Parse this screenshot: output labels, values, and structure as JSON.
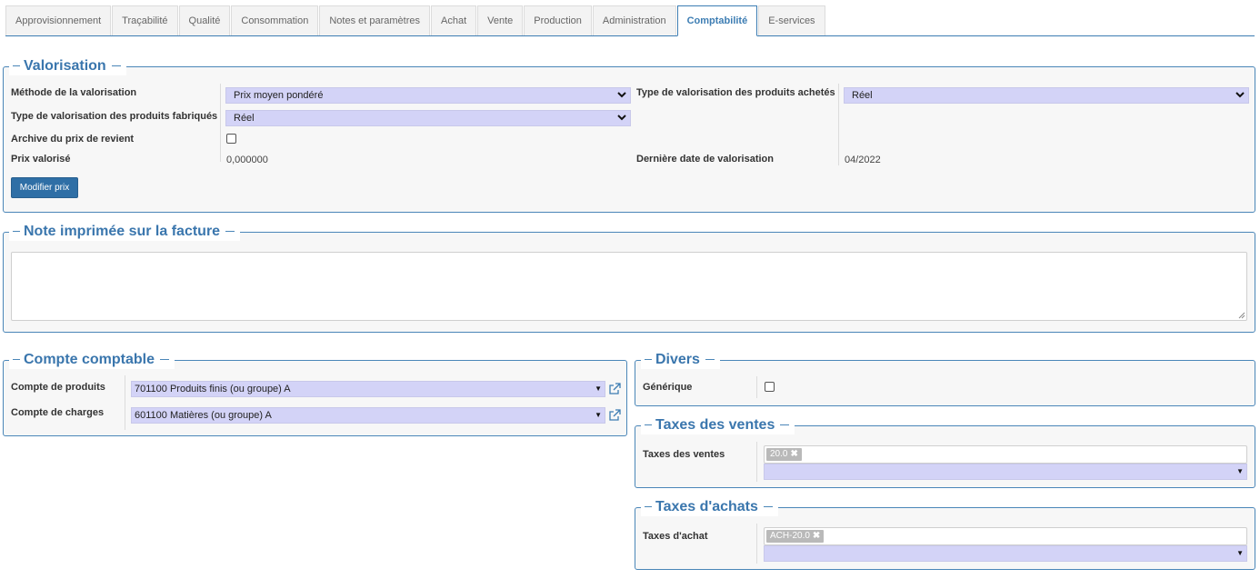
{
  "tabs": [
    {
      "label": "Approvisionnement"
    },
    {
      "label": "Traçabilité"
    },
    {
      "label": "Qualité"
    },
    {
      "label": "Consommation"
    },
    {
      "label": "Notes et paramètres"
    },
    {
      "label": "Achat"
    },
    {
      "label": "Vente"
    },
    {
      "label": "Production"
    },
    {
      "label": "Administration"
    },
    {
      "label": "Comptabilité",
      "active": true
    },
    {
      "label": "E-services"
    }
  ],
  "valorisation": {
    "legend": "Valorisation",
    "methode_label": "Méthode de la valorisation",
    "methode_value": "Prix moyen pondéré",
    "type_fab_label": "Type de valorisation des produits fabriqués",
    "type_fab_value": "Réel",
    "archive_label": "Archive du prix de revient",
    "prix_label": "Prix valorisé",
    "prix_value": "0,000000",
    "type_ach_label": "Type de valorisation des produits achetés",
    "type_ach_value": "Réel",
    "derniere_label": "Dernière date de valorisation",
    "derniere_value": "04/2022",
    "modifier_button": "Modifier prix"
  },
  "note": {
    "legend": "Note imprimée sur la facture",
    "value": ""
  },
  "compte": {
    "legend": "Compte comptable",
    "produits_label": "Compte de produits",
    "produits_value": "701100 Produits finis (ou groupe) A",
    "charges_label": "Compte de charges",
    "charges_value": "601100 Matières (ou groupe) A"
  },
  "divers": {
    "legend": "Divers",
    "generique_label": "Générique"
  },
  "taxes_ventes": {
    "legend": "Taxes des ventes",
    "label": "Taxes des ventes",
    "tag": "20.0"
  },
  "taxes_achats": {
    "legend": "Taxes d'achats",
    "label": "Taxes d'achat",
    "tag": "ACH-20.0"
  },
  "colors": {
    "accent": "#3d7db3",
    "select_bg": "#d3d3f7",
    "button_bg": "#2f6fa6"
  }
}
